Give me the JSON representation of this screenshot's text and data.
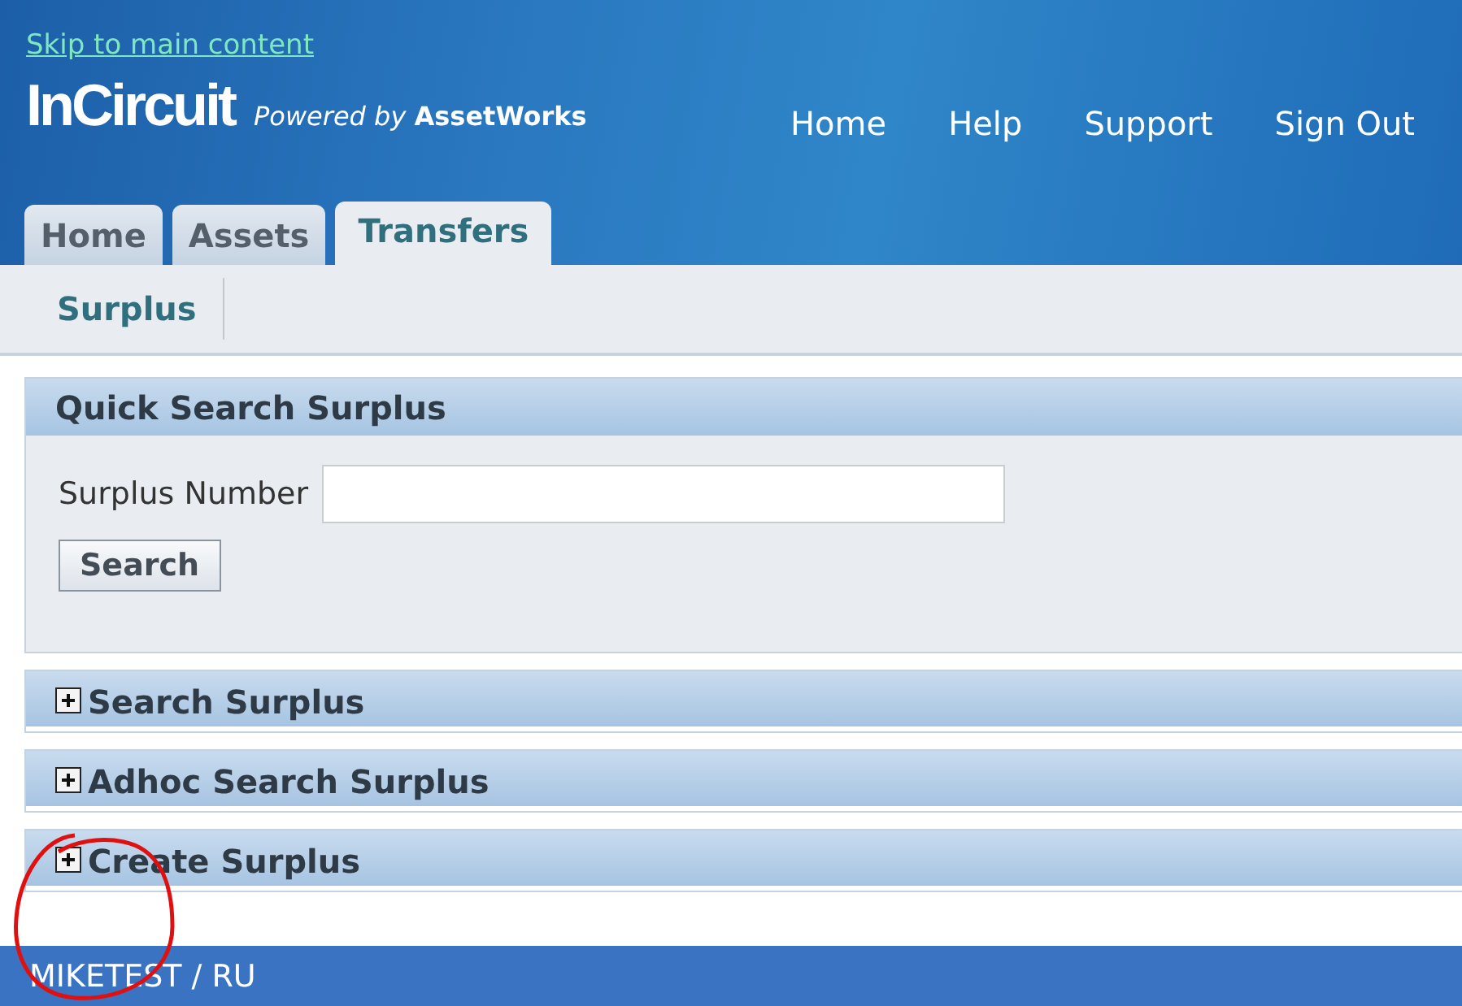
{
  "header": {
    "skip_link": "Skip to main content",
    "logo": "InCircuit",
    "tagline": "*Powered by* **AssetWorks**",
    "links": [
      "Home",
      "Help",
      "Support",
      "Sign Out"
    ]
  },
  "tabs": [
    {
      "label": "Home",
      "selected": false
    },
    {
      "label": "Assets",
      "selected": false
    },
    {
      "label": "Transfers",
      "selected": true
    }
  ],
  "subtabs": [
    {
      "label": "Surplus"
    }
  ],
  "quick_search": {
    "title": "Quick Search Surplus",
    "field_label": "Surplus Number",
    "button": "Search"
  },
  "sections": [
    {
      "title": "Search Surplus",
      "expanded": false
    },
    {
      "title": "Adhoc Search Surplus",
      "expanded": false
    },
    {
      "title": "Create Surplus",
      "expanded": false
    }
  ],
  "annotation": {
    "kind": "circle"
  },
  "footer": {
    "user": "MIKETEST / RU"
  }
}
